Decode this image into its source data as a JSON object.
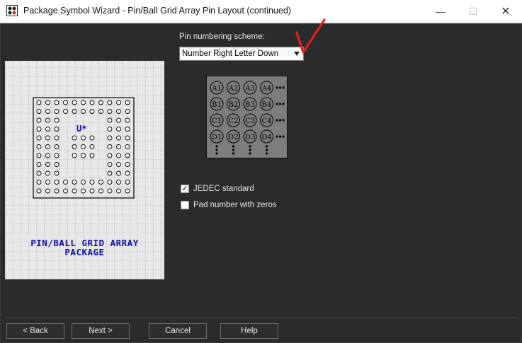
{
  "window": {
    "title": "Package Symbol Wizard - Pin/Ball Grid Array Pin Layout (continued)",
    "minimize_glyph": "—",
    "maximize_glyph": "☐",
    "close_glyph": "✕",
    "icon": "package-wizard-icon"
  },
  "preview_image": {
    "component_label": "U*",
    "title_line1": "PIN/BALL GRID ARRAY",
    "title_line2": "PACKAGE"
  },
  "pin_numbering": {
    "label": "Pin numbering scheme:",
    "selected": "Number Right Letter Down"
  },
  "grid_preview": {
    "rows": [
      [
        "A1",
        "A2",
        "A3",
        "A4"
      ],
      [
        "B1",
        "B2",
        "B3",
        "B4"
      ],
      [
        "C1",
        "C2",
        "C3",
        "C4"
      ],
      [
        "D1",
        "D2",
        "D3",
        "D4"
      ]
    ],
    "continuation": "..."
  },
  "options": {
    "jedec": {
      "label": "JEDEC standard",
      "checked": true,
      "mark": "✓"
    },
    "zeros": {
      "label": "Pad number with zeros",
      "checked": false,
      "mark": ""
    }
  },
  "buttons": {
    "back": "< Back",
    "next": "Next >",
    "cancel": "Cancel",
    "help": "Help"
  },
  "colors": {
    "background": "#2b2b2b",
    "package_text": "#1010b0",
    "annotation": "#e02020"
  }
}
